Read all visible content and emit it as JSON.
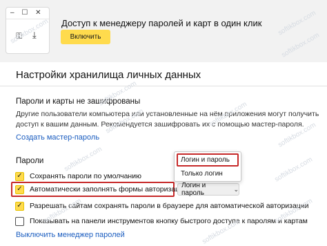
{
  "promo": {
    "title": "Доступ к менеджеру паролей и карт в один клик",
    "button": "Включить",
    "mini_window": {
      "controls": "–  ☐  ✕"
    }
  },
  "settings": {
    "section_title": "Настройки хранилища личных данных",
    "not_encrypted_title": "Пароли и карты не зашифрованы",
    "description": "Другие пользователи компьютера или установленные на нём приложения могут получить доступ к вашим данным. Рекомендуется зашифровать их с помощью мастер-пароля.",
    "create_master_link": "Создать мастер-пароль",
    "passwords_label": "Пароли",
    "options": [
      {
        "label": "Сохранять пароли по умолчанию",
        "checked": true
      },
      {
        "label": "Автоматически заполнять формы авторизации",
        "checked": true
      },
      {
        "label": "Разрешать сайтам сохранять пароли в браузере для автоматической авторизации",
        "checked": true
      },
      {
        "label": "Показывать на панели инструментов кнопку быстрого доступа к паролям и картам",
        "checked": false
      }
    ],
    "autofill_select": {
      "value": "Логин и пароль"
    },
    "dropdown_options": [
      "Логин и пароль",
      "Только логин"
    ],
    "disable_link": "Выключить менеджер паролей"
  },
  "watermark": "softikbox.com",
  "colors": {
    "accent": "#ffdb4d",
    "link": "#1a5cbf",
    "highlight": "#c62828"
  },
  "icons": {
    "minimize": "minimize-icon",
    "maximize": "maximize-icon",
    "close": "close-icon",
    "key": "key-icon",
    "download": "download-icon",
    "check": "check-icon",
    "chevron": "chevron-down-icon"
  }
}
